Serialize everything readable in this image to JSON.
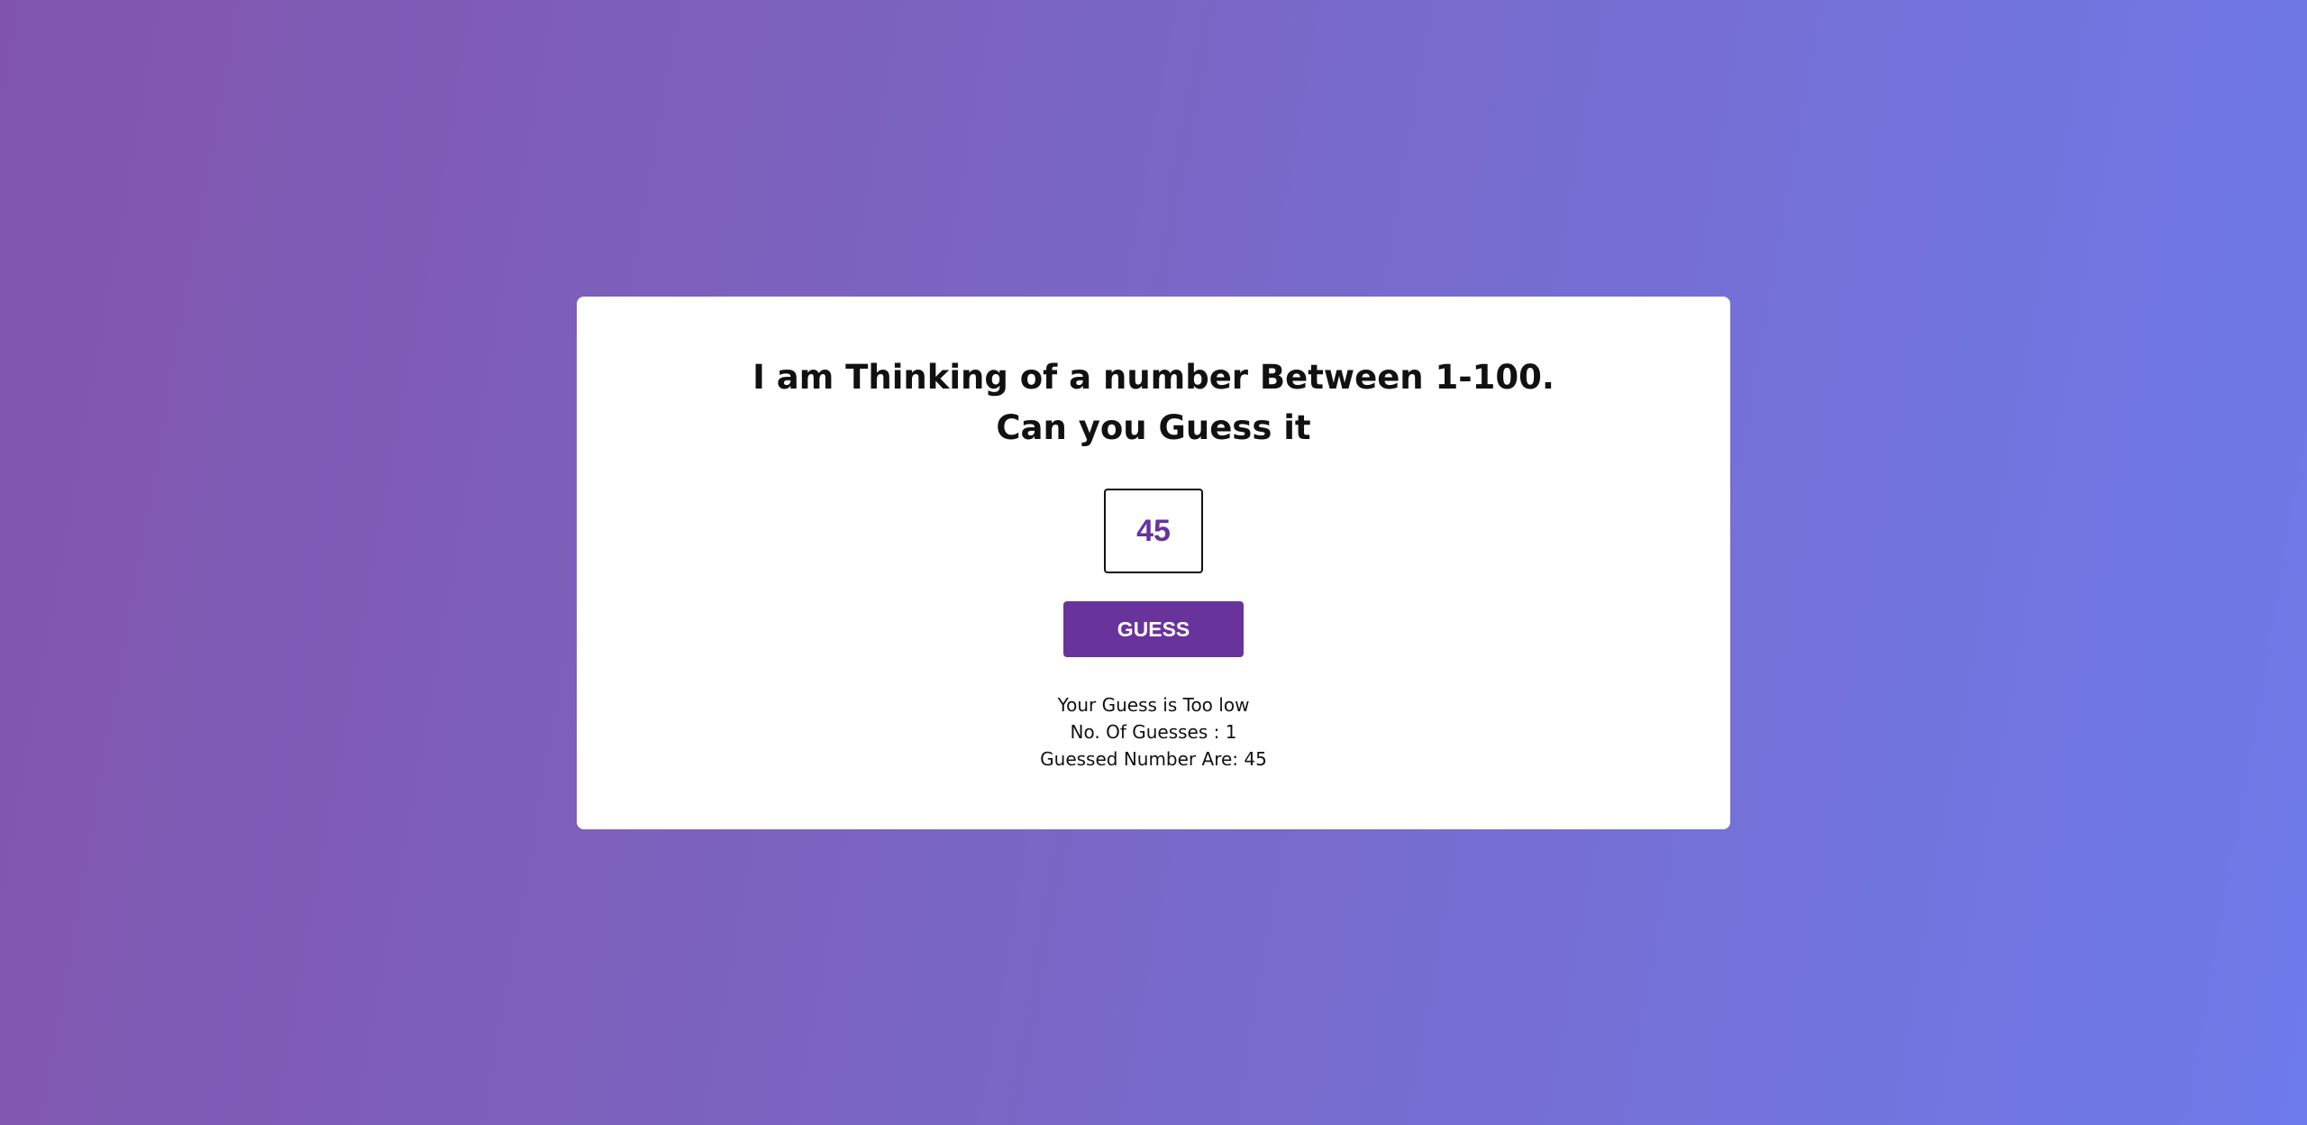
{
  "game": {
    "title_line1": "I am Thinking of a number Between 1-100.",
    "title_line2": "Can you Guess it",
    "input_value": "45",
    "button_label": "GUESS",
    "feedback": "Your Guess is Too low",
    "guess_count": "No. Of Guesses : 1",
    "guessed_numbers": "Guessed Number Are: 45"
  },
  "colors": {
    "accent": "#68349b",
    "input_text": "#6633a0",
    "background_start": "#8155ad",
    "background_end": "#6e7bea"
  }
}
